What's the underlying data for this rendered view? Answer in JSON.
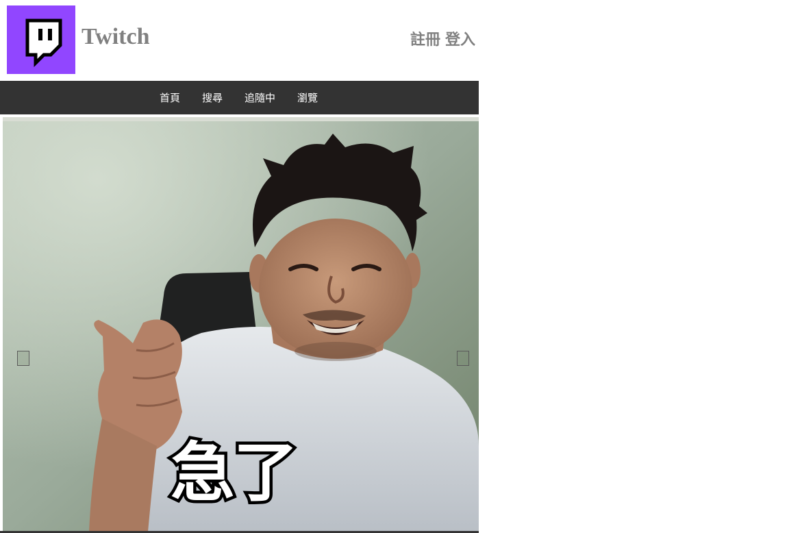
{
  "header": {
    "brand": "Twitch",
    "logo_icon": "twitch-glitch-icon",
    "logo_bg": "#9146FF",
    "auth": {
      "register": "註冊",
      "login": "登入"
    }
  },
  "nav": {
    "items": [
      {
        "label": "首頁"
      },
      {
        "label": "搜尋"
      },
      {
        "label": "追隨中"
      },
      {
        "label": "瀏覽"
      }
    ]
  },
  "slideshow": {
    "caption": "急了",
    "prev_icon": "prev-slide-icon",
    "next_icon": "next-slide-icon"
  },
  "colors": {
    "brand_text": "#808080",
    "nav_bg": "#333333",
    "nav_text": "#FFFFFF"
  }
}
